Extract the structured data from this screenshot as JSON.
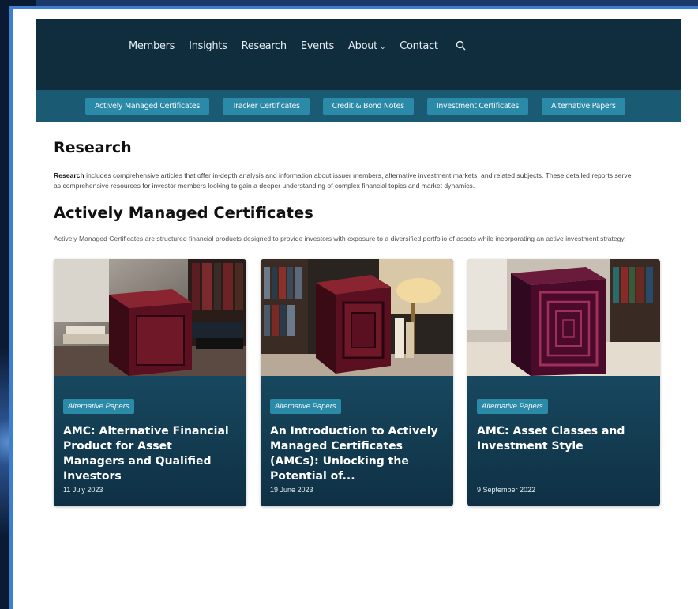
{
  "nav": {
    "items": [
      "Members",
      "Insights",
      "Research",
      "Events",
      "About",
      "Contact"
    ],
    "about_chevron": "⌄",
    "search_icon": "search-icon"
  },
  "categories": [
    "Actively Managed Certificates",
    "Tracker Certificates",
    "Credit & Bond Notes",
    "Investment Certificates",
    "Alternative Papers"
  ],
  "research": {
    "title": "Research",
    "intro_bold": "Research",
    "intro_rest": " includes comprehensive articles that offer in-depth analysis and information about issuer members, alternative investment markets, and related subjects. These detailed reports serve as comprehensive resources for investor members looking to gain a deeper understanding of complex financial topics and market dynamics."
  },
  "section": {
    "title": "Actively Managed Certificates",
    "description": "Actively Managed Certificates are structured financial products designed to provide investors with exposure to a diversified portfolio of assets while incorporating an active investment strategy."
  },
  "cards": [
    {
      "tag": "Alternative Papers",
      "title": "AMC: Alternative Financial Product for Asset Managers and Qualified Investors",
      "date": "11 July 2023"
    },
    {
      "tag": "Alternative Papers",
      "title": "An Introduction to Actively Managed Certificates (AMCs): Unlocking the Potential of...",
      "date": "19 June 2023"
    },
    {
      "tag": "Alternative Papers",
      "title": "AMC: Asset Classes and Investment Style",
      "date": "9 September 2022"
    }
  ],
  "colors": {
    "topnav": "#0f2d3d",
    "catbar": "#1a5a72",
    "button": "#2b8aa8",
    "card": "#1f5d77"
  }
}
